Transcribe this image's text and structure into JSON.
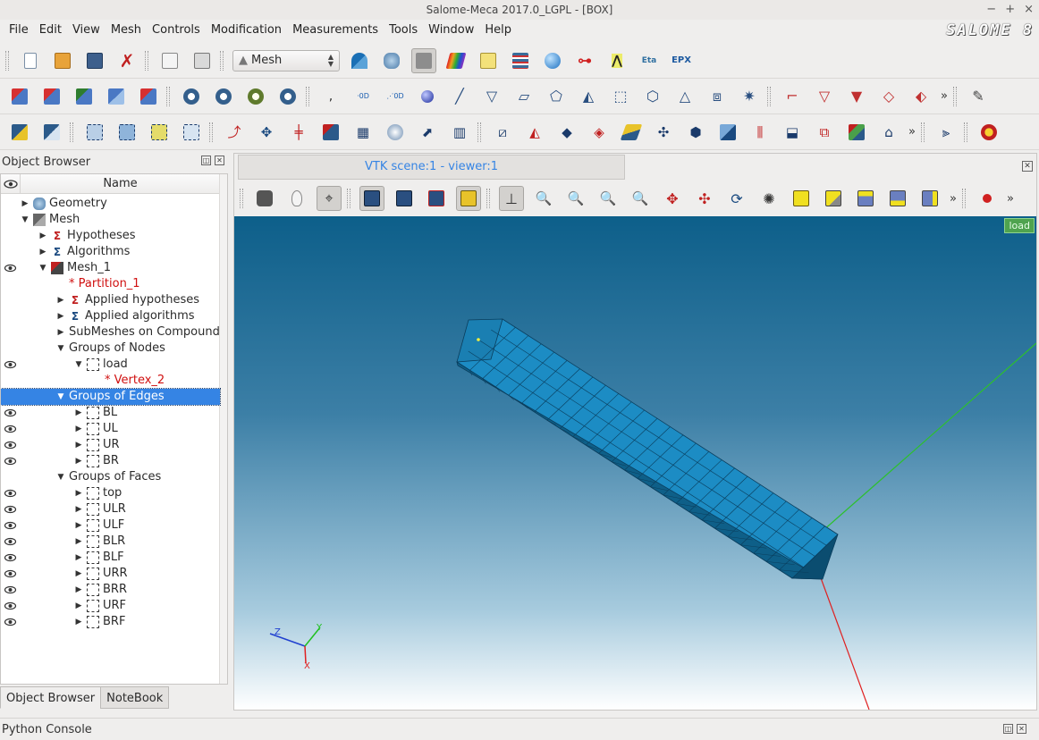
{
  "window": {
    "title": "Salome-Meca 2017.0_LGPL - [BOX]",
    "controls": [
      "−",
      "+",
      "×"
    ]
  },
  "menu": [
    "File",
    "Edit",
    "View",
    "Mesh",
    "Controls",
    "Modification",
    "Measurements",
    "Tools",
    "Window",
    "Help"
  ],
  "logo": "SALOME 8",
  "toolbar1": {
    "module_combo": "Mesh",
    "epx_label": "EPX"
  },
  "object_browser": {
    "title": "Object Browser",
    "column_name": "Name",
    "rows": [
      {
        "label": "Geometry",
        "level": 1,
        "arrow": "▶",
        "icon": "geometry-icon",
        "eye": false,
        "red": false
      },
      {
        "label": "Mesh",
        "level": 1,
        "arrow": "▼",
        "icon": "mesh-icon",
        "eye": false,
        "red": false
      },
      {
        "label": "Hypotheses",
        "level": 2,
        "arrow": "▶",
        "icon": "hypotheses-icon",
        "eye": false,
        "red": false
      },
      {
        "label": "Algorithms",
        "level": 2,
        "arrow": "▶",
        "icon": "algorithms-icon",
        "eye": false,
        "red": false
      },
      {
        "label": "Mesh_1",
        "level": 2,
        "arrow": "▼",
        "icon": "mesh-object-icon",
        "eye": true,
        "red": false
      },
      {
        "label": "* Partition_1",
        "level": 3,
        "arrow": "",
        "icon": "",
        "eye": false,
        "red": true
      },
      {
        "label": "Applied hypotheses",
        "level": 3,
        "arrow": "▶",
        "icon": "hypotheses-icon",
        "eye": false,
        "red": false
      },
      {
        "label": "Applied algorithms",
        "level": 3,
        "arrow": "▶",
        "icon": "algorithms-icon",
        "eye": false,
        "red": false
      },
      {
        "label": "SubMeshes on Compound",
        "level": 3,
        "arrow": "▶",
        "icon": "",
        "eye": false,
        "red": false
      },
      {
        "label": "Groups of Nodes",
        "level": 3,
        "arrow": "▼",
        "icon": "",
        "eye": false,
        "red": false
      },
      {
        "label": "load",
        "level": 4,
        "arrow": "▼",
        "icon": "group-icon",
        "eye": true,
        "red": false
      },
      {
        "label": "* Vertex_2",
        "level": 5,
        "arrow": "",
        "icon": "",
        "eye": false,
        "red": true
      },
      {
        "label": "Groups of Edges",
        "level": 3,
        "arrow": "▼",
        "icon": "",
        "eye": false,
        "red": false,
        "selected": true
      },
      {
        "label": "BL",
        "level": 4,
        "arrow": "▶",
        "icon": "group-icon",
        "eye": true,
        "red": false
      },
      {
        "label": "UL",
        "level": 4,
        "arrow": "▶",
        "icon": "group-icon",
        "eye": true,
        "red": false
      },
      {
        "label": "UR",
        "level": 4,
        "arrow": "▶",
        "icon": "group-icon",
        "eye": true,
        "red": false
      },
      {
        "label": "BR",
        "level": 4,
        "arrow": "▶",
        "icon": "group-icon",
        "eye": true,
        "red": false
      },
      {
        "label": "Groups of Faces",
        "level": 3,
        "arrow": "▼",
        "icon": "",
        "eye": false,
        "red": false
      },
      {
        "label": "top",
        "level": 4,
        "arrow": "▶",
        "icon": "group-icon",
        "eye": true,
        "red": false
      },
      {
        "label": "ULR",
        "level": 4,
        "arrow": "▶",
        "icon": "group-icon",
        "eye": true,
        "red": false
      },
      {
        "label": "ULF",
        "level": 4,
        "arrow": "▶",
        "icon": "group-icon",
        "eye": true,
        "red": false
      },
      {
        "label": "BLR",
        "level": 4,
        "arrow": "▶",
        "icon": "group-icon",
        "eye": true,
        "red": false
      },
      {
        "label": "BLF",
        "level": 4,
        "arrow": "▶",
        "icon": "group-icon",
        "eye": true,
        "red": false
      },
      {
        "label": "URR",
        "level": 4,
        "arrow": "▶",
        "icon": "group-icon",
        "eye": true,
        "red": false
      },
      {
        "label": "BRR",
        "level": 4,
        "arrow": "▶",
        "icon": "group-icon",
        "eye": true,
        "red": false
      },
      {
        "label": "URF",
        "level": 4,
        "arrow": "▶",
        "icon": "group-icon",
        "eye": true,
        "red": false
      },
      {
        "label": "BRF",
        "level": 4,
        "arrow": "▶",
        "icon": "group-icon",
        "eye": true,
        "red": false
      }
    ]
  },
  "bottom_tabs": [
    "Object Browser",
    "NoteBook"
  ],
  "viewer": {
    "tab_title": "VTK scene:1 - viewer:1",
    "badge": "load",
    "axes": {
      "x": "X",
      "y": "Y",
      "z": "Z"
    }
  },
  "console": {
    "title": "Python Console"
  },
  "colors": {
    "selection": "#3584e4",
    "mesh_face": "#1c8cc4",
    "mesh_edge": "#0a3d5c",
    "axis_x": "#e02020",
    "axis_y": "#20c020",
    "axis_z": "#2040d0",
    "red_text": "#d01010"
  }
}
